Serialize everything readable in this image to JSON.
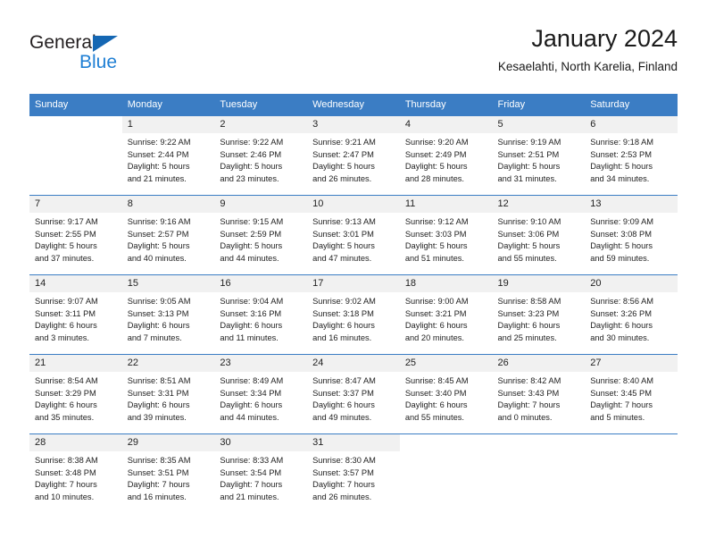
{
  "logo": {
    "word_one": "General",
    "word_two": "Blue",
    "triangle_icon": "triangle-icon",
    "brand_blue": "#1f7fd4",
    "triangle_blue": "#1567b3"
  },
  "header": {
    "title": "January 2024",
    "subtitle": "Kesaelahti, North Karelia, Finland"
  },
  "colors": {
    "header_band": "#3b7dc4",
    "daynum_background": "#f1f1f1",
    "text": "#222222"
  },
  "weekday_headers": [
    "Sunday",
    "Monday",
    "Tuesday",
    "Wednesday",
    "Thursday",
    "Friday",
    "Saturday"
  ],
  "weeks": [
    [
      {
        "day": "",
        "sunrise": "",
        "sunset": "",
        "daylight_line1": "",
        "daylight_line2": ""
      },
      {
        "day": "1",
        "sunrise": "Sunrise: 9:22 AM",
        "sunset": "Sunset: 2:44 PM",
        "daylight_line1": "Daylight: 5 hours",
        "daylight_line2": "and 21 minutes."
      },
      {
        "day": "2",
        "sunrise": "Sunrise: 9:22 AM",
        "sunset": "Sunset: 2:46 PM",
        "daylight_line1": "Daylight: 5 hours",
        "daylight_line2": "and 23 minutes."
      },
      {
        "day": "3",
        "sunrise": "Sunrise: 9:21 AM",
        "sunset": "Sunset: 2:47 PM",
        "daylight_line1": "Daylight: 5 hours",
        "daylight_line2": "and 26 minutes."
      },
      {
        "day": "4",
        "sunrise": "Sunrise: 9:20 AM",
        "sunset": "Sunset: 2:49 PM",
        "daylight_line1": "Daylight: 5 hours",
        "daylight_line2": "and 28 minutes."
      },
      {
        "day": "5",
        "sunrise": "Sunrise: 9:19 AM",
        "sunset": "Sunset: 2:51 PM",
        "daylight_line1": "Daylight: 5 hours",
        "daylight_line2": "and 31 minutes."
      },
      {
        "day": "6",
        "sunrise": "Sunrise: 9:18 AM",
        "sunset": "Sunset: 2:53 PM",
        "daylight_line1": "Daylight: 5 hours",
        "daylight_line2": "and 34 minutes."
      }
    ],
    [
      {
        "day": "7",
        "sunrise": "Sunrise: 9:17 AM",
        "sunset": "Sunset: 2:55 PM",
        "daylight_line1": "Daylight: 5 hours",
        "daylight_line2": "and 37 minutes."
      },
      {
        "day": "8",
        "sunrise": "Sunrise: 9:16 AM",
        "sunset": "Sunset: 2:57 PM",
        "daylight_line1": "Daylight: 5 hours",
        "daylight_line2": "and 40 minutes."
      },
      {
        "day": "9",
        "sunrise": "Sunrise: 9:15 AM",
        "sunset": "Sunset: 2:59 PM",
        "daylight_line1": "Daylight: 5 hours",
        "daylight_line2": "and 44 minutes."
      },
      {
        "day": "10",
        "sunrise": "Sunrise: 9:13 AM",
        "sunset": "Sunset: 3:01 PM",
        "daylight_line1": "Daylight: 5 hours",
        "daylight_line2": "and 47 minutes."
      },
      {
        "day": "11",
        "sunrise": "Sunrise: 9:12 AM",
        "sunset": "Sunset: 3:03 PM",
        "daylight_line1": "Daylight: 5 hours",
        "daylight_line2": "and 51 minutes."
      },
      {
        "day": "12",
        "sunrise": "Sunrise: 9:10 AM",
        "sunset": "Sunset: 3:06 PM",
        "daylight_line1": "Daylight: 5 hours",
        "daylight_line2": "and 55 minutes."
      },
      {
        "day": "13",
        "sunrise": "Sunrise: 9:09 AM",
        "sunset": "Sunset: 3:08 PM",
        "daylight_line1": "Daylight: 5 hours",
        "daylight_line2": "and 59 minutes."
      }
    ],
    [
      {
        "day": "14",
        "sunrise": "Sunrise: 9:07 AM",
        "sunset": "Sunset: 3:11 PM",
        "daylight_line1": "Daylight: 6 hours",
        "daylight_line2": "and 3 minutes."
      },
      {
        "day": "15",
        "sunrise": "Sunrise: 9:05 AM",
        "sunset": "Sunset: 3:13 PM",
        "daylight_line1": "Daylight: 6 hours",
        "daylight_line2": "and 7 minutes."
      },
      {
        "day": "16",
        "sunrise": "Sunrise: 9:04 AM",
        "sunset": "Sunset: 3:16 PM",
        "daylight_line1": "Daylight: 6 hours",
        "daylight_line2": "and 11 minutes."
      },
      {
        "day": "17",
        "sunrise": "Sunrise: 9:02 AM",
        "sunset": "Sunset: 3:18 PM",
        "daylight_line1": "Daylight: 6 hours",
        "daylight_line2": "and 16 minutes."
      },
      {
        "day": "18",
        "sunrise": "Sunrise: 9:00 AM",
        "sunset": "Sunset: 3:21 PM",
        "daylight_line1": "Daylight: 6 hours",
        "daylight_line2": "and 20 minutes."
      },
      {
        "day": "19",
        "sunrise": "Sunrise: 8:58 AM",
        "sunset": "Sunset: 3:23 PM",
        "daylight_line1": "Daylight: 6 hours",
        "daylight_line2": "and 25 minutes."
      },
      {
        "day": "20",
        "sunrise": "Sunrise: 8:56 AM",
        "sunset": "Sunset: 3:26 PM",
        "daylight_line1": "Daylight: 6 hours",
        "daylight_line2": "and 30 minutes."
      }
    ],
    [
      {
        "day": "21",
        "sunrise": "Sunrise: 8:54 AM",
        "sunset": "Sunset: 3:29 PM",
        "daylight_line1": "Daylight: 6 hours",
        "daylight_line2": "and 35 minutes."
      },
      {
        "day": "22",
        "sunrise": "Sunrise: 8:51 AM",
        "sunset": "Sunset: 3:31 PM",
        "daylight_line1": "Daylight: 6 hours",
        "daylight_line2": "and 39 minutes."
      },
      {
        "day": "23",
        "sunrise": "Sunrise: 8:49 AM",
        "sunset": "Sunset: 3:34 PM",
        "daylight_line1": "Daylight: 6 hours",
        "daylight_line2": "and 44 minutes."
      },
      {
        "day": "24",
        "sunrise": "Sunrise: 8:47 AM",
        "sunset": "Sunset: 3:37 PM",
        "daylight_line1": "Daylight: 6 hours",
        "daylight_line2": "and 49 minutes."
      },
      {
        "day": "25",
        "sunrise": "Sunrise: 8:45 AM",
        "sunset": "Sunset: 3:40 PM",
        "daylight_line1": "Daylight: 6 hours",
        "daylight_line2": "and 55 minutes."
      },
      {
        "day": "26",
        "sunrise": "Sunrise: 8:42 AM",
        "sunset": "Sunset: 3:43 PM",
        "daylight_line1": "Daylight: 7 hours",
        "daylight_line2": "and 0 minutes."
      },
      {
        "day": "27",
        "sunrise": "Sunrise: 8:40 AM",
        "sunset": "Sunset: 3:45 PM",
        "daylight_line1": "Daylight: 7 hours",
        "daylight_line2": "and 5 minutes."
      }
    ],
    [
      {
        "day": "28",
        "sunrise": "Sunrise: 8:38 AM",
        "sunset": "Sunset: 3:48 PM",
        "daylight_line1": "Daylight: 7 hours",
        "daylight_line2": "and 10 minutes."
      },
      {
        "day": "29",
        "sunrise": "Sunrise: 8:35 AM",
        "sunset": "Sunset: 3:51 PM",
        "daylight_line1": "Daylight: 7 hours",
        "daylight_line2": "and 16 minutes."
      },
      {
        "day": "30",
        "sunrise": "Sunrise: 8:33 AM",
        "sunset": "Sunset: 3:54 PM",
        "daylight_line1": "Daylight: 7 hours",
        "daylight_line2": "and 21 minutes."
      },
      {
        "day": "31",
        "sunrise": "Sunrise: 8:30 AM",
        "sunset": "Sunset: 3:57 PM",
        "daylight_line1": "Daylight: 7 hours",
        "daylight_line2": "and 26 minutes."
      },
      {
        "day": "",
        "sunrise": "",
        "sunset": "",
        "daylight_line1": "",
        "daylight_line2": ""
      },
      {
        "day": "",
        "sunrise": "",
        "sunset": "",
        "daylight_line1": "",
        "daylight_line2": ""
      },
      {
        "day": "",
        "sunrise": "",
        "sunset": "",
        "daylight_line1": "",
        "daylight_line2": ""
      }
    ]
  ]
}
